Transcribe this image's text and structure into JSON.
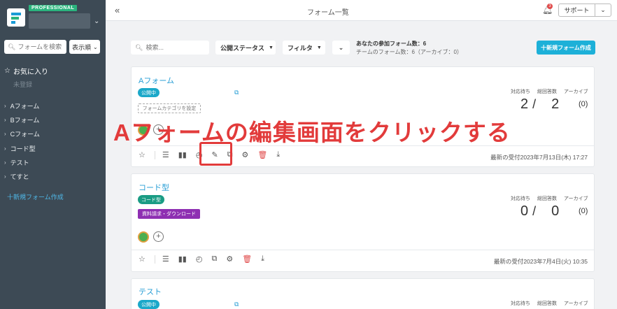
{
  "sidebar": {
    "badge": "PROFESSIONAL",
    "search_placeholder": "フォームを検索",
    "sort_label": "表示順",
    "favorites_label": "お気に入り",
    "unregistered_label": "未登録",
    "items": [
      {
        "label": "Aフォーム"
      },
      {
        "label": "Bフォーム"
      },
      {
        "label": "Cフォーム"
      },
      {
        "label": "コード型"
      },
      {
        "label": "テスト"
      },
      {
        "label": "てすと"
      }
    ],
    "new_form_label": "十新規フォーム作成"
  },
  "header": {
    "title": "フォーム一覧",
    "notification_count": "3",
    "support_label": "サポート"
  },
  "toolbar": {
    "search_placeholder": "検索...",
    "status_label": "公開ステータス",
    "filter_label": "フィルタ",
    "participating_count": "あなたの参加フォーム数：6",
    "team_count": "チームのフォーム数：6（アーカイブ：0）",
    "new_form_button": "十新規フォーム作成"
  },
  "stats_labels": {
    "pending": "対応待ち",
    "total": "総回答数",
    "archive": "アーカイブ"
  },
  "cards": [
    {
      "title": "Aフォーム",
      "status": "公開中",
      "category_button": "フォームカテゴリを設定",
      "pending": "2",
      "total": "2",
      "archive": "(0)",
      "last_received": "最新の受付2023年7月13日(木) 17:27"
    },
    {
      "title": "コード型",
      "status": "コード型",
      "category_tag": "資料請求・ダウンロード",
      "pending": "0",
      "total": "0",
      "archive": "(0)",
      "last_received": "最新の受付2023年7月4日(火) 10:35"
    },
    {
      "title": "テスト",
      "status": "公開中"
    }
  ],
  "annotation": {
    "text": "Aフォームの編集画面をクリックする",
    "color": "#e23b3b"
  },
  "colors": {
    "sidebar_bg": "#3d4a55",
    "accent": "#1db0d8",
    "pro_badge": "#2bb47e"
  }
}
